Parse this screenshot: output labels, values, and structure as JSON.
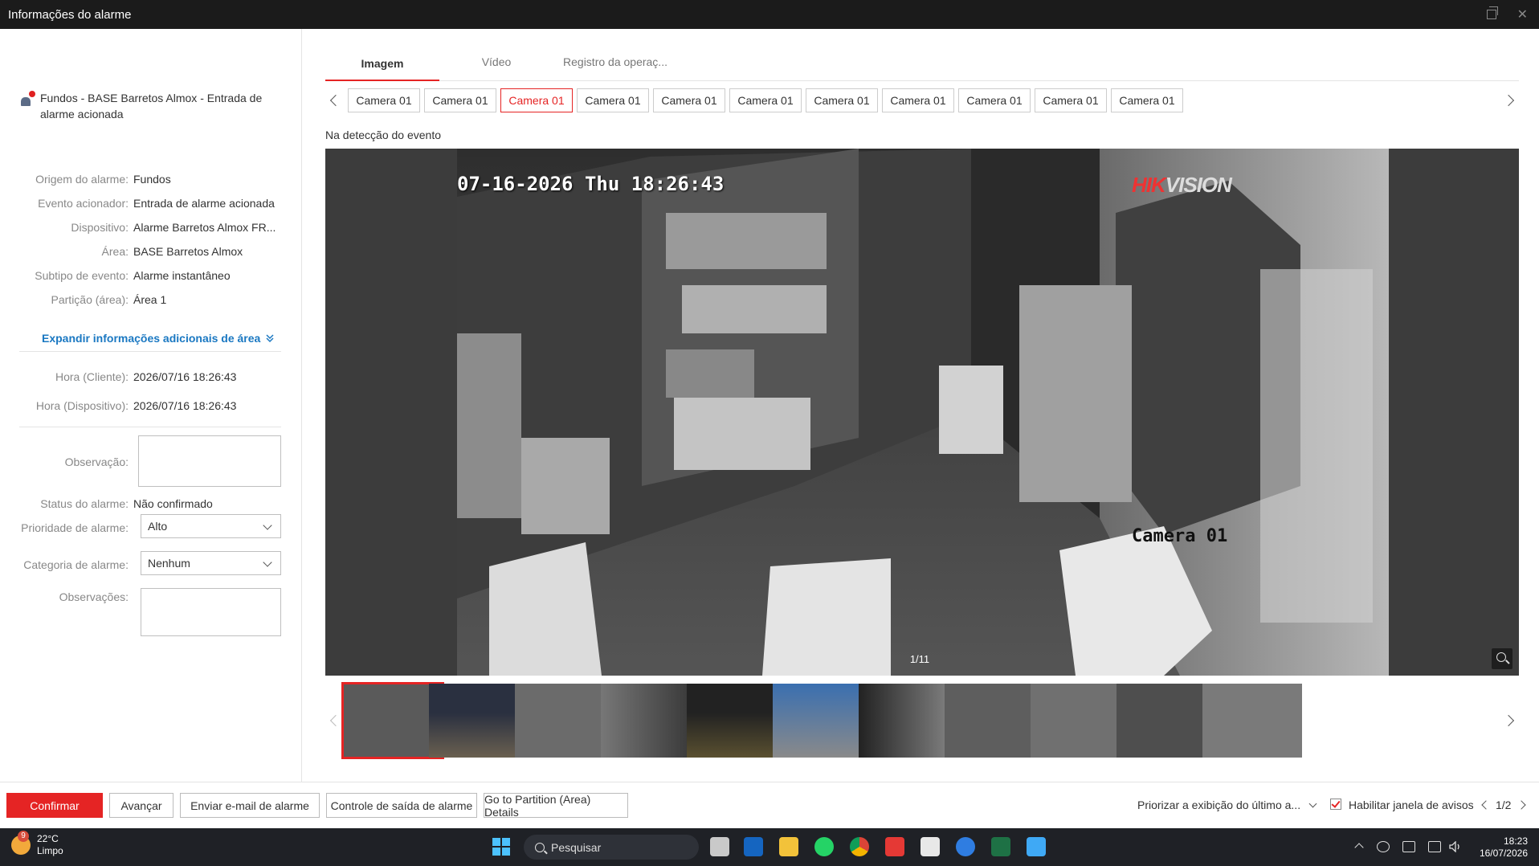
{
  "window": {
    "title": "Informações do alarme"
  },
  "alarm": {
    "title": "Fundos - BASE Barretos Almox - Entrada de alarme acionada",
    "details": [
      {
        "label": "Origem do alarme:",
        "value": "Fundos"
      },
      {
        "label": "Evento acionador:",
        "value": "Entrada de alarme acionada"
      },
      {
        "label": "Dispositivo:",
        "value": "Alarme Barretos Almox FR..."
      },
      {
        "label": "Área:",
        "value": "BASE Barretos Almox"
      },
      {
        "label": "Subtipo de evento:",
        "value": "Alarme instantâneo"
      },
      {
        "label": "Partição (área):",
        "value": "Área 1"
      }
    ],
    "expand_label": "Expandir informações adicionais de área",
    "times": [
      {
        "label": "Hora (Cliente):",
        "value": "2026/07/16 18:26:43"
      },
      {
        "label": "Hora (Dispositivo):",
        "value": "2026/07/16 18:26:43"
      }
    ],
    "observation_label": "Observação:",
    "observation_value": "",
    "status_label": "Status do alarme:",
    "status_value": "Não confirmado",
    "priority_label": "Prioridade de alarme:",
    "priority_value": "Alto",
    "category_label": "Categoria de alarme:",
    "category_value": "Nenhum",
    "notes_label": "Observações:",
    "notes_value": ""
  },
  "tabs": [
    "Imagem",
    "Vídeo",
    "Registro da operaç..."
  ],
  "cameras": [
    "Camera 01",
    "Camera 01",
    "Camera 01",
    "Camera 01",
    "Camera 01",
    "Camera 01",
    "Camera 01",
    "Camera 01",
    "Camera 01",
    "Camera 01",
    "Camera 01"
  ],
  "active_camera_index": 2,
  "viewer": {
    "subtitle": "Na detecção do evento",
    "osd_time": "07-16-2026 Thu 18:26:43",
    "osd_brand_red": "HIK",
    "osd_brand_rest": "VISION",
    "osd_camera": "Camera 01",
    "counter": "1/11"
  },
  "thumbnails_count": 11,
  "bottom": {
    "confirm": "Confirmar",
    "next": "Avançar",
    "email": "Enviar e-mail de alarme",
    "output": "Controle de saída de alarme",
    "partition": "Go to Partition (Area) Details",
    "priority_display": "Priorizar a exibição do último a...",
    "enable_popup": "Habilitar janela de avisos",
    "page": "1/2"
  },
  "taskbar": {
    "temp": "22°C",
    "weather": "Limpo",
    "weather_badge": "9",
    "search": "Pesquisar",
    "time": "18:23",
    "date": "16/07/2026"
  },
  "colors": {
    "accent": "#e52424",
    "link": "#1a78c2",
    "titlebar": "#1b1b1b",
    "taskbar": "#1f2126"
  }
}
